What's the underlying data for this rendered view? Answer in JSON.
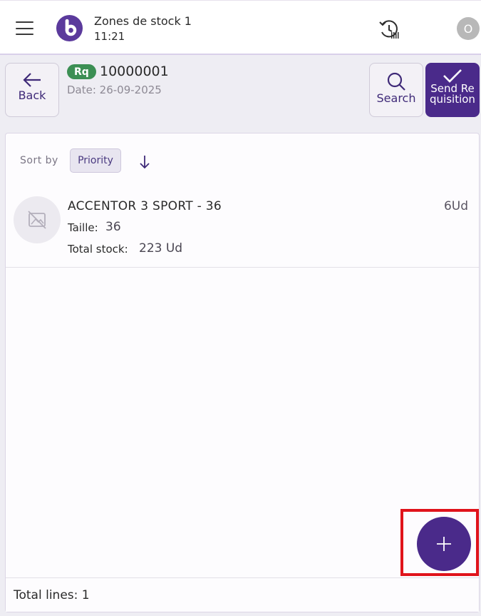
{
  "header": {
    "title": "Zones de stock 1",
    "time": "11:21",
    "avatar_initial": "O",
    "brand_color": "#5b3a9c"
  },
  "toolbar": {
    "back_label": "Back",
    "search_label": "Search",
    "send_label": "Send Requisition"
  },
  "requisition": {
    "badge": "Rq",
    "number": "10000001",
    "date": "Date: 26-09-2025"
  },
  "sort": {
    "label": "Sort by",
    "selected": "Priority",
    "direction": "descending"
  },
  "items": [
    {
      "name": "ACCENTOR 3 SPORT - 36",
      "qty": "6",
      "qty_unit": "Ud",
      "attr1_label": "Taille:",
      "attr1_value": "36",
      "attr2_label": "Total stock:",
      "attr2_value": "223 Ud"
    }
  ],
  "footer": {
    "total_lines": "Total lines: 1"
  },
  "colors": {
    "primary": "#4a2a8a",
    "badge_green": "#3c8f54",
    "highlight_red": "#e0131b"
  },
  "icons": {
    "menu": "hamburger-menu-icon",
    "history": "history-icon",
    "back": "arrow-left-icon",
    "search": "search-icon",
    "send": "check-icon",
    "sort_direction": "arrow-down-icon",
    "thumbnail": "image-placeholder-icon",
    "add": "plus-icon"
  }
}
